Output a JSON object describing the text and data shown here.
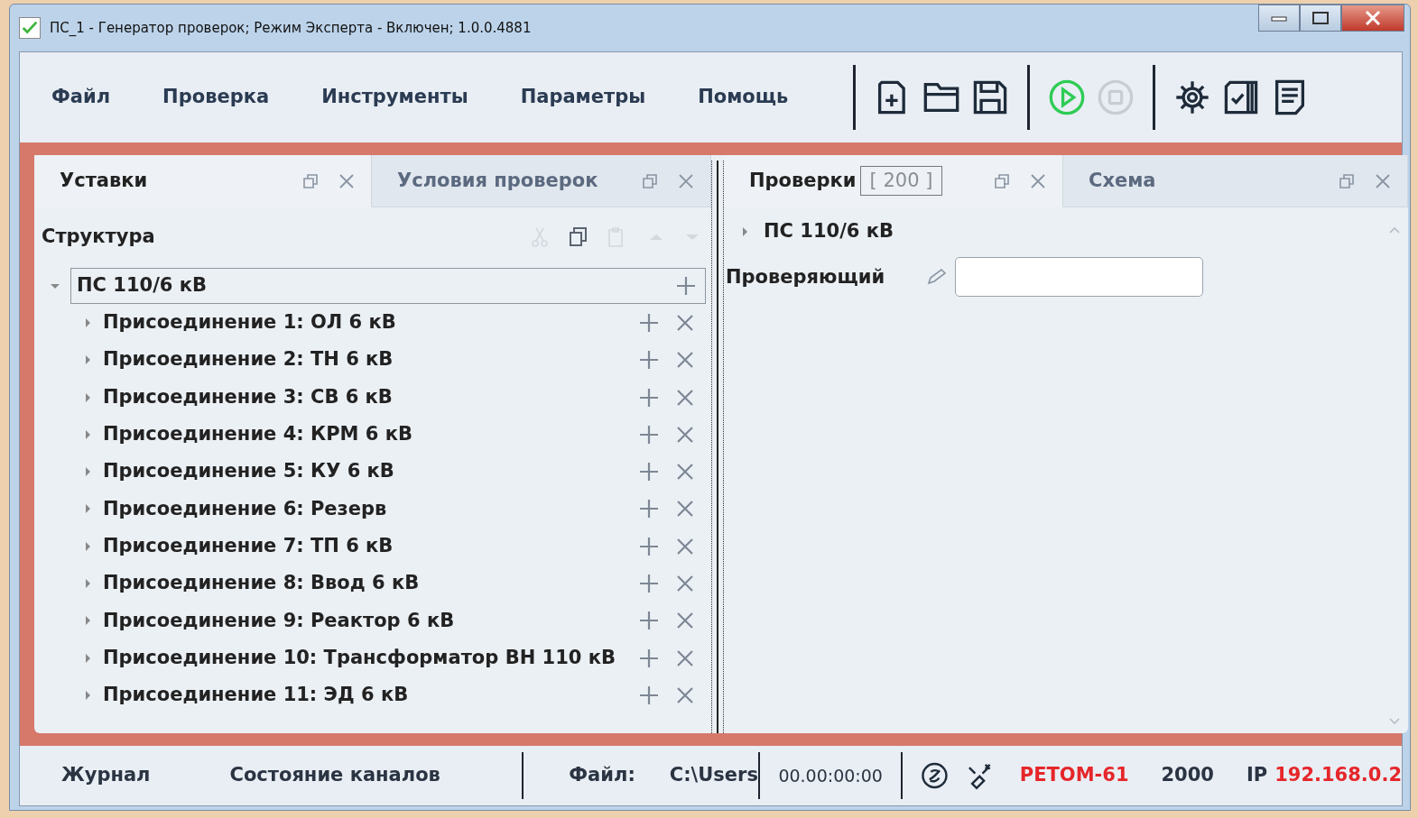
{
  "window": {
    "title": "ПС_1 - Генератор проверок; Режим Эксперта - Включен; 1.0.0.4881"
  },
  "menu": [
    "Файл",
    "Проверка",
    "Инструменты",
    "Параметры",
    "Помощь"
  ],
  "toolbar": [
    [
      {
        "kind": "new",
        "disabled": false
      },
      {
        "kind": "open",
        "disabled": false
      },
      {
        "kind": "save",
        "disabled": false
      }
    ],
    [
      {
        "kind": "run",
        "disabled": false
      },
      {
        "kind": "stop",
        "disabled": true
      }
    ],
    [
      {
        "kind": "settings",
        "disabled": false
      },
      {
        "kind": "checklist",
        "disabled": false
      },
      {
        "kind": "report",
        "disabled": false
      }
    ]
  ],
  "left_tabs": [
    {
      "label": "Уставки",
      "selected": true
    },
    {
      "label": "Условия проверок",
      "selected": false
    }
  ],
  "right_tabs": [
    {
      "label": "Проверки",
      "count": "[ 200 ]",
      "selected": true
    },
    {
      "label": "Схема",
      "selected": false
    }
  ],
  "structure": {
    "title": "Структура",
    "tools": [
      {
        "kind": "cut",
        "disabled": true
      },
      {
        "kind": "copy",
        "disabled": false
      },
      {
        "kind": "paste",
        "disabled": true
      },
      {
        "kind": "up",
        "disabled": true
      },
      {
        "kind": "down",
        "disabled": true
      }
    ],
    "tree": [
      {
        "label": "ПС 110/6 кВ",
        "expanded": true,
        "children": [
          {
            "label": "Присоединение 1: ОЛ 6 кВ",
            "expanded": false
          },
          {
            "label": "Присоединение 2: ТН 6 кВ",
            "expanded": false
          },
          {
            "label": "Присоединение 3: СВ 6 кВ",
            "expanded": false
          },
          {
            "label": "Присоединение 4: КРМ 6 кВ",
            "expanded": false
          },
          {
            "label": "Присоединение 5: КУ 6 кВ",
            "expanded": false
          },
          {
            "label": "Присоединение 6: Резерв",
            "expanded": false
          },
          {
            "label": "Присоединение 7: ТП 6 кВ",
            "expanded": false
          },
          {
            "label": "Присоединение 8: Ввод 6 кВ",
            "expanded": false
          },
          {
            "label": "Присоединение 9: Реактор 6 кВ",
            "expanded": false
          },
          {
            "label": "Присоединение 10: Трансформатор ВН 110 кВ",
            "expanded": false
          },
          {
            "label": "Присоединение 11: ЭД 6 кВ",
            "expanded": false
          }
        ]
      }
    ]
  },
  "checks": {
    "tree": [
      {
        "label": "ПС 110/6 кВ",
        "expanded": false
      }
    ],
    "fields": [
      {
        "label": "Проверяющий"
      }
    ]
  },
  "status_bar": {
    "tabs": [
      "Журнал",
      "Состояние каналов"
    ],
    "file_label": "Файл:",
    "file_path": "C:\\Users",
    "timer": "00.00:00:00",
    "device": "РЕТОМ-61",
    "port": "2000",
    "ip_label": "IP",
    "ip": "192.168.0.2"
  }
}
